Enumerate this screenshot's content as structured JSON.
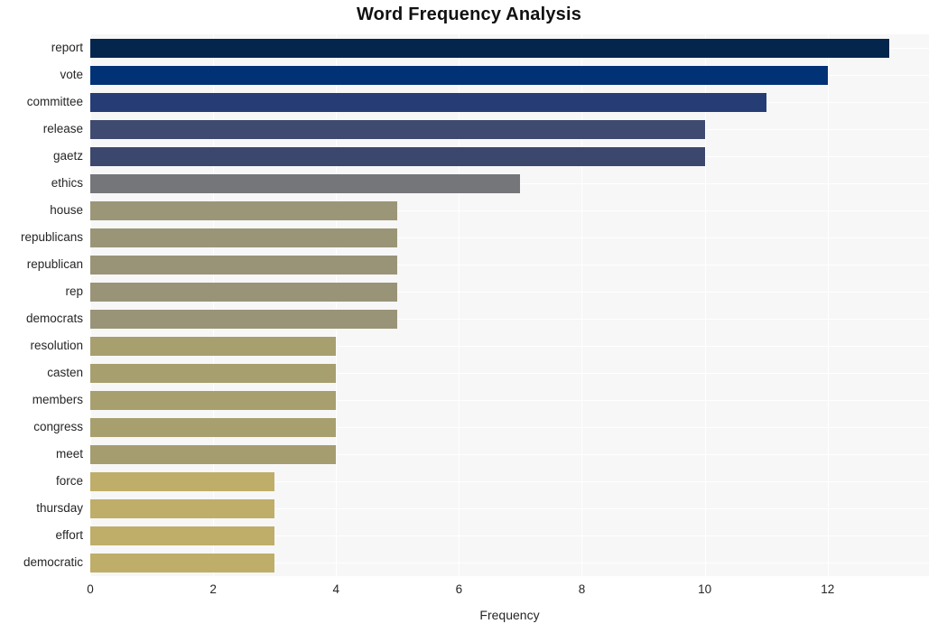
{
  "chart_data": {
    "type": "bar",
    "orientation": "horizontal",
    "title": "Word Frequency Analysis",
    "xlabel": "Frequency",
    "ylabel": "",
    "categories": [
      "report",
      "vote",
      "committee",
      "release",
      "gaetz",
      "ethics",
      "house",
      "republicans",
      "republican",
      "rep",
      "democrats",
      "resolution",
      "casten",
      "members",
      "congress",
      "meet",
      "force",
      "thursday",
      "effort",
      "democratic"
    ],
    "values": [
      13,
      12,
      11,
      10,
      10,
      7,
      5,
      5,
      5,
      5,
      5,
      4,
      4,
      4,
      4,
      4,
      3,
      3,
      3,
      3
    ],
    "xticks": [
      0,
      2,
      4,
      6,
      8,
      10,
      12
    ],
    "xtick_labels": [
      "0",
      "2",
      "4",
      "6",
      "8",
      "10",
      "12"
    ],
    "xlim": [
      0,
      13.65
    ],
    "grid": true,
    "legend": null,
    "bar_colors": [
      "#04264d",
      "#013275",
      "#253d74",
      "#3e4a70",
      "#3c476d",
      "#75767a",
      "#9b9677",
      "#9a9577",
      "#999478",
      "#999478",
      "#999477",
      "#a89f6f",
      "#a89f6f",
      "#a89f6f",
      "#a89f6f",
      "#a59d70",
      "#bfae69",
      "#bfae69",
      "#bfae69",
      "#bfae69"
    ],
    "plot_background": "#f7f7f7",
    "grid_color": "#ffffff",
    "figure_background": "#ffffff"
  }
}
